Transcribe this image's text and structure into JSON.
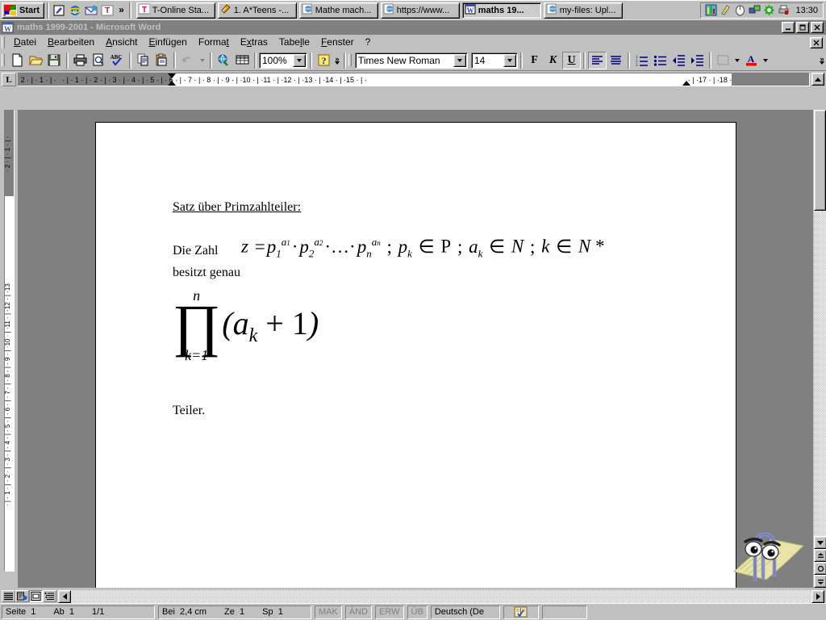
{
  "taskbar": {
    "start_label": "Start",
    "quicklaunch": [
      {
        "name": "show-desktop-icon",
        "glyph": "✎"
      },
      {
        "name": "internet-explorer-icon",
        "glyph": "e"
      },
      {
        "name": "outlook-express-icon",
        "glyph": "✉"
      },
      {
        "name": "t-online-icon",
        "glyph": "T"
      }
    ],
    "quicklaunch_more": "»",
    "tasks": [
      {
        "label": "T-Online Sta...",
        "icon": "t-online-icon",
        "active": false
      },
      {
        "label": "1. A*Teens -...",
        "icon": "media-icon",
        "active": false
      },
      {
        "label": "Mathe mach...",
        "icon": "ie-page-icon",
        "active": false
      },
      {
        "label": "https://www...",
        "icon": "ie-page-icon",
        "active": false
      },
      {
        "label": "maths 19...",
        "icon": "word-icon",
        "active": true
      },
      {
        "label": "my-files: Upl...",
        "icon": "ie-page-icon",
        "active": false
      }
    ],
    "tray": [
      {
        "name": "volume-mixer-icon"
      },
      {
        "name": "lightning-icon"
      },
      {
        "name": "mouse-icon"
      },
      {
        "name": "network-icon"
      },
      {
        "name": "virus-scanner-icon"
      },
      {
        "name": "printer-icon"
      }
    ],
    "clock": "13:30"
  },
  "window": {
    "title": "maths 1999-2001  -  Microsoft Word",
    "buttons": {
      "minimize": "_",
      "maximize": "□",
      "close": "✕"
    },
    "doc_close": "✕"
  },
  "menu": {
    "items": [
      {
        "label": "Datei",
        "accel": "D"
      },
      {
        "label": "Bearbeiten",
        "accel": "B"
      },
      {
        "label": "Ansicht",
        "accel": "A"
      },
      {
        "label": "Einfügen",
        "accel": "E"
      },
      {
        "label": "Format",
        "accel": "t"
      },
      {
        "label": "Extras",
        "accel": "x"
      },
      {
        "label": "Tabelle",
        "accel": "l"
      },
      {
        "label": "Fenster",
        "accel": "F"
      },
      {
        "label": "?",
        "accel": ""
      }
    ]
  },
  "toolbar": {
    "standard": [
      {
        "name": "new-document-button",
        "tip": "Neu"
      },
      {
        "name": "open-document-button",
        "tip": "Öffnen"
      },
      {
        "name": "save-button",
        "tip": "Speichern"
      },
      {
        "name": "print-button",
        "tip": "Drucken"
      },
      {
        "name": "print-preview-button",
        "tip": "Seitenansicht"
      },
      {
        "name": "spellcheck-button",
        "tip": "Rechtschreibung"
      },
      {
        "name": "copy-button",
        "tip": "Kopieren"
      },
      {
        "name": "paste-button",
        "tip": "Einfügen"
      },
      {
        "name": "undo-button",
        "tip": "Rückgängig"
      },
      {
        "name": "hyperlink-button",
        "tip": "Hyperlink"
      },
      {
        "name": "tables-borders-button",
        "tip": "Tabellen und Rahmen"
      }
    ],
    "zoom_value": "100%",
    "help_button": "?",
    "more_chevron": "»",
    "font_value": "Times New Roman",
    "size_value": "14",
    "bold_label": "F",
    "italic_label": "K",
    "underline_label": "U",
    "underline_active": true,
    "align_left_active": true,
    "format_buttons": [
      {
        "name": "align-left-button"
      },
      {
        "name": "align-justify-button"
      },
      {
        "name": "numbered-list-button"
      },
      {
        "name": "bulleted-list-button"
      },
      {
        "name": "decrease-indent-button"
      },
      {
        "name": "increase-indent-button"
      },
      {
        "name": "borders-button"
      },
      {
        "name": "font-color-button"
      }
    ]
  },
  "ruler": {
    "tab_stop_glyph": "L",
    "horizontal_marks": [
      "2",
      "1",
      "1",
      "2",
      "3",
      "4",
      "5",
      "6",
      "7",
      "8",
      "9",
      "10",
      "11",
      "12",
      "13",
      "14",
      "15",
      "17",
      "18"
    ],
    "vertical_marks": [
      "2",
      "1",
      "1",
      "2",
      "3",
      "4",
      "5",
      "6",
      "7",
      "8",
      "9",
      "10",
      "11",
      "12",
      "13"
    ]
  },
  "document": {
    "heading": "Satz über Primzahlteiler:",
    "line1": "Die Zahl",
    "line2": "besitzt genau",
    "line3": "Teiler.",
    "equation_inline": {
      "lhs": "z",
      "eq": "=",
      "terms": [
        {
          "base": "p",
          "sub": "1",
          "sup": "a₁"
        },
        {
          "base": "p",
          "sub": "2",
          "sup": "a₂"
        },
        {
          "base": "p",
          "sub": "n",
          "sup": "aₙ"
        }
      ],
      "plain": "z = p₁^a₁ · p₂^a₂ ·...· pₙ^aₙ ; pₖ ∈ P ; aₖ ∈ N ; k ∈ N*",
      "conditions": "pₖ ∈ P ; aₖ ∈ N ; k ∈ N*"
    },
    "equation_product": {
      "upper_limit": "n",
      "lower_limit": "k=1",
      "symbol": "∏",
      "body": "(aₖ + 1)",
      "plain": "∏(k=1..n) (aₖ + 1)"
    }
  },
  "view_buttons": [
    {
      "name": "normal-view-button",
      "active": false
    },
    {
      "name": "web-layout-view-button",
      "active": false
    },
    {
      "name": "print-layout-view-button",
      "active": true
    },
    {
      "name": "outline-view-button",
      "active": false
    }
  ],
  "statusbar": {
    "page_label": "Seite",
    "page_value": "1",
    "section_label": "Ab",
    "section_value": "1",
    "pages": "1/1",
    "at_label": "Bei",
    "at_value": "2,4 cm",
    "line_label": "Ze",
    "line_value": "1",
    "col_label": "Sp",
    "col_value": "1",
    "modes": [
      "MAK",
      "ÄND",
      "ERW",
      "ÜB"
    ],
    "language": "Deutsch (De",
    "spellcheck_icon": "spellcheck-status-icon"
  },
  "assistant": {
    "name": "office-assistant-clippy"
  },
  "colors": {
    "desktop": "#008080",
    "chrome": "#c0c0c0",
    "inactive_title": "#808080",
    "page_bg": "#808080",
    "accent_red": "#ff0000",
    "accent_blue": "#000080"
  }
}
